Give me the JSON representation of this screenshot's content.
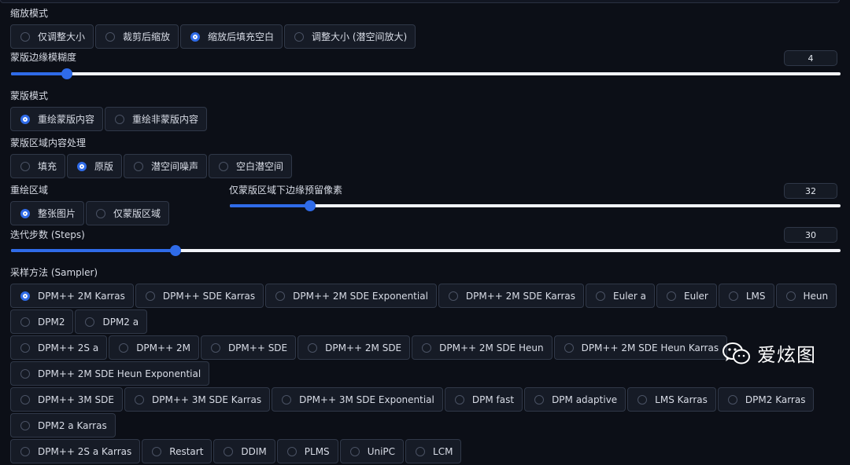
{
  "resize_mode": {
    "label": "缩放模式",
    "options": [
      "仅调整大小",
      "裁剪后缩放",
      "缩放后填充空白",
      "调整大小 (潜空间放大)"
    ],
    "selected": 2
  },
  "mask_blur": {
    "label": "蒙版边缘模糊度",
    "value": "4",
    "fraction": 0.067
  },
  "mask_mode": {
    "label": "蒙版模式",
    "options": [
      "重绘蒙版内容",
      "重绘非蒙版内容"
    ],
    "selected": 0
  },
  "masked_content": {
    "label": "蒙版区域内容处理",
    "options": [
      "填充",
      "原版",
      "潜空间噪声",
      "空白潜空间"
    ],
    "selected": 1
  },
  "inpaint_area": {
    "label": "重绘区域",
    "options": [
      "整张图片",
      "仅蒙版区域"
    ],
    "selected": 0
  },
  "only_masked_padding": {
    "label": "仅蒙版区域下边缘预留像素",
    "value": "32",
    "fraction": 0.132
  },
  "steps": {
    "label": "迭代步数 (Steps)",
    "value": "30",
    "fraction": 0.198
  },
  "sampler": {
    "label": "采样方法 (Sampler)",
    "rows": [
      [
        "DPM++ 2M Karras",
        "DPM++ SDE Karras",
        "DPM++ 2M SDE Exponential",
        "DPM++ 2M SDE Karras",
        "Euler a",
        "Euler",
        "LMS",
        "Heun",
        "DPM2",
        "DPM2 a"
      ],
      [
        "DPM++ 2S a",
        "DPM++ 2M",
        "DPM++ SDE",
        "DPM++ 2M SDE",
        "DPM++ 2M SDE Heun",
        "DPM++ 2M SDE Heun Karras",
        "DPM++ 2M SDE Heun Exponential"
      ],
      [
        "DPM++ 3M SDE",
        "DPM++ 3M SDE Karras",
        "DPM++ 3M SDE Exponential",
        "DPM fast",
        "DPM adaptive",
        "LMS Karras",
        "DPM2 Karras",
        "DPM2 a Karras"
      ],
      [
        "DPM++ 2S a Karras",
        "Restart",
        "DDIM",
        "PLMS",
        "UniPC",
        "LCM"
      ]
    ],
    "selected": "DPM++ 2M Karras"
  },
  "watermark": {
    "text": "爱炫图",
    "icon": "wechat-icon"
  },
  "colors": {
    "accent": "#2f6be8",
    "background": "#0c0f17",
    "radio_bg": "#161b26",
    "border": "#303848"
  }
}
